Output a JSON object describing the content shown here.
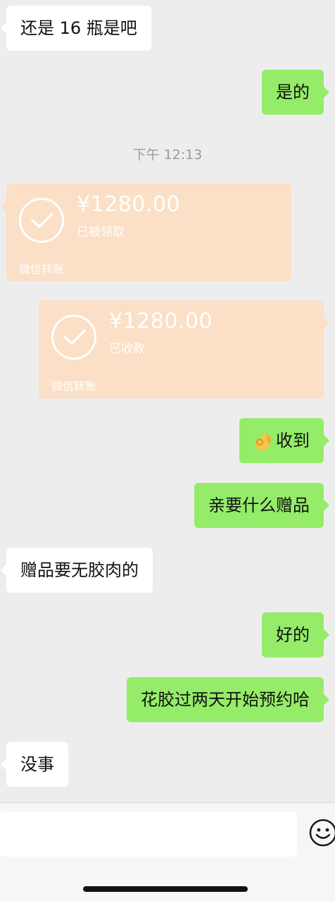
{
  "chat": {
    "messages": [
      {
        "side": "in",
        "text": "还是 16 瓶是吧"
      },
      {
        "side": "out",
        "text": "是的"
      },
      {
        "side": "out",
        "text": "收到",
        "emoji": "ok-hand-icon"
      },
      {
        "side": "out",
        "text": "亲要什么赠品"
      },
      {
        "side": "in",
        "text": "赠品要无胶肉的"
      },
      {
        "side": "out",
        "text": "好的"
      },
      {
        "side": "out",
        "text": "花胶过两天开始预约哈"
      },
      {
        "side": "in",
        "text": "没事"
      }
    ],
    "timestamp": "下午 12:13",
    "transfers": [
      {
        "side": "in",
        "amount": "¥1280.00",
        "status": "已被领取",
        "label": "微信转账"
      },
      {
        "side": "out",
        "amount": "¥1280.00",
        "status": "已收款",
        "label": "微信转账"
      }
    ]
  },
  "input_bar": {
    "input_value": "",
    "emoji_button_icon": "smiley-icon"
  },
  "colors": {
    "background": "#ededed",
    "incoming_bubble": "#ffffff",
    "outgoing_bubble": "#95ec69",
    "transfer_card": "#fbdfc6"
  }
}
